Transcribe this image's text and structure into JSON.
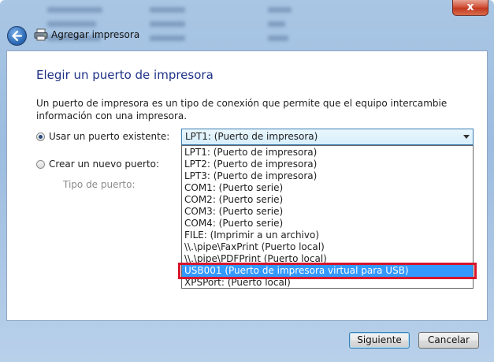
{
  "window": {
    "title": "Agregar impresora",
    "close_label": "x"
  },
  "heading": "Elegir un puerto de impresora",
  "description": "Un puerto de impresora es un tipo de conexión que permite que el equipo intercambie información con una impresora.",
  "options": {
    "existing_label": "Usar un puerto existente:",
    "new_label": "Crear un nuevo puerto:",
    "port_type_label": "Tipo de puerto:"
  },
  "port_select": {
    "selected": "LPT1: (Puerto de impresora)",
    "items": [
      "LPT1: (Puerto de impresora)",
      "LPT2: (Puerto de impresora)",
      "LPT3: (Puerto de impresora)",
      "COM1: (Puerto serie)",
      "COM2: (Puerto serie)",
      "COM3: (Puerto serie)",
      "COM4: (Puerto serie)",
      "FILE: (Imprimir a un archivo)",
      "\\\\.\\pipe\\FaxPrint (Puerto local)",
      "\\\\.\\pipe\\PDFPrint (Puerto local)",
      "USB001 (Puerto de impresora virtual para USB)",
      "XPSPort: (Puerto local)"
    ],
    "highlighted_index": 10
  },
  "buttons": {
    "next": "Siguiente",
    "cancel": "Cancelar"
  },
  "colors": {
    "heading": "#1e3287",
    "selection": "#3399ff",
    "annotation_box": "#d8142c"
  }
}
